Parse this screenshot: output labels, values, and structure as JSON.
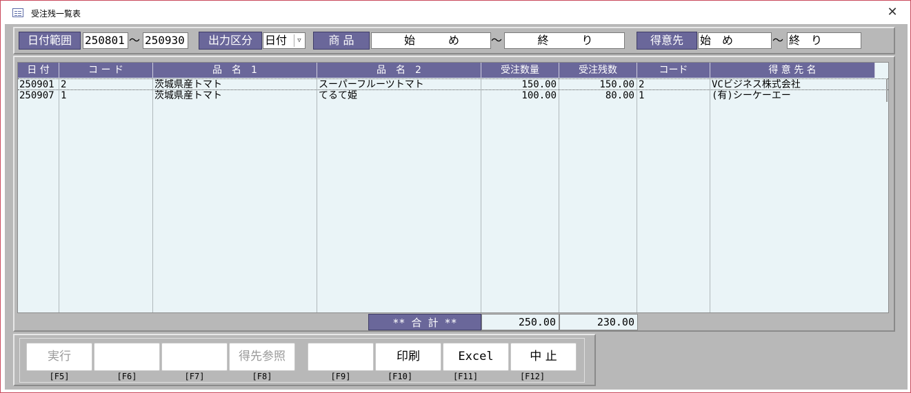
{
  "window": {
    "title": "受注残一覧表"
  },
  "filters": {
    "date_range_label": "日付範囲",
    "date_from": "250801",
    "date_to": "250930",
    "tilde": "～",
    "output_label": "出力区分",
    "output_value": "日付",
    "product_label": "商 品",
    "product_from": "始　　　め",
    "product_to": "終　　　り",
    "customer_label": "得意先",
    "customer_from": "始　め",
    "customer_to": "終　り"
  },
  "grid": {
    "columns": [
      "日 付",
      "コ ー ド",
      "品　名　1",
      "品　名　2",
      "受注数量",
      "受注残数",
      "コード",
      "得 意 先 名"
    ],
    "rows": [
      [
        "250901",
        "2",
        "茨城県産トマト",
        "スーパーフルーツトマト",
        "150.00",
        "150.00",
        "2",
        "VCビジネス株式会社"
      ],
      [
        "250907",
        "1",
        "茨城県産トマト",
        "てるて姫",
        "100.00",
        "80.00",
        "1",
        "(有)シーケーエー"
      ]
    ]
  },
  "totals": {
    "label": "** 合 計 **",
    "order_qty": "250.00",
    "remaining_qty": "230.00"
  },
  "buttons": [
    {
      "label": "実行",
      "key": "[F5]",
      "enabled": false
    },
    {
      "label": "",
      "key": "[F6]",
      "enabled": false
    },
    {
      "label": "",
      "key": "[F7]",
      "enabled": false
    },
    {
      "label": "得先参照",
      "key": "[F8]",
      "enabled": false
    },
    {
      "label": "",
      "key": "[F9]",
      "enabled": false
    },
    {
      "label": "印刷",
      "key": "[F10]",
      "enabled": true
    },
    {
      "label": "Excel",
      "key": "[F11]",
      "enabled": true
    },
    {
      "label": "中 止",
      "key": "[F12]",
      "enabled": true
    }
  ]
}
